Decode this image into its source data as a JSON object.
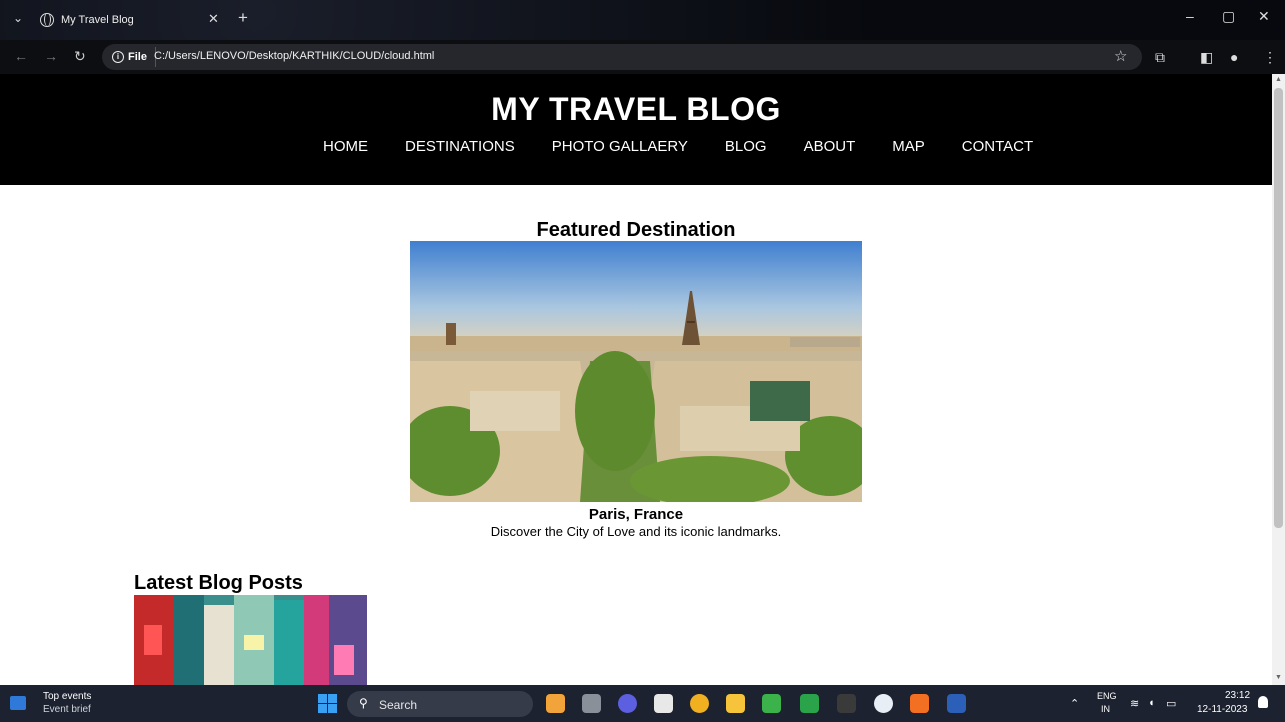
{
  "browser": {
    "tab_title": "My Travel Blog",
    "file_label": "File",
    "url": "C:/Users/LENOVO/Desktop/KARTHIK/CLOUD/cloud.html"
  },
  "site": {
    "title": "MY TRAVEL BLOG",
    "nav": [
      "HOME",
      "DESTINATIONS",
      "PHOTO GALLAERY",
      "BLOG",
      "ABOUT",
      "MAP",
      "CONTACT"
    ]
  },
  "featured": {
    "heading": "Featured Destination",
    "name": "Paris, France",
    "description": "Discover the City of Love and its iconic landmarks."
  },
  "blog": {
    "heading": "Latest Blog Posts"
  },
  "taskbar": {
    "weather_title": "Top events",
    "weather_sub": "Event brief",
    "search_label": "Search",
    "lang_line1": "ENG",
    "lang_line2": "IN",
    "time": "23:12",
    "date": "12-11-2023"
  },
  "colors": {
    "header_bg": "#000000",
    "page_bg": "#ffffff",
    "taskbar_bg": "#1c2230"
  },
  "icons": [
    "globe-icon",
    "close-icon",
    "plus-icon",
    "back-icon",
    "forward-icon",
    "reload-icon",
    "info-icon",
    "star-icon",
    "extensions-icon",
    "sidepanel-icon",
    "profile-icon",
    "menu-icon",
    "windows-start-icon",
    "search-icon",
    "notification-icon"
  ]
}
